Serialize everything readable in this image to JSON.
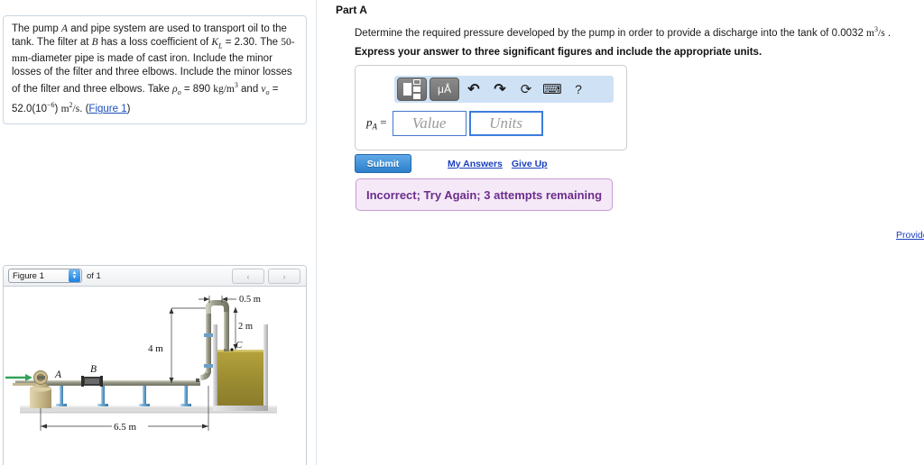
{
  "problem": {
    "segments": [
      {
        "t": "The pump ",
        "k": "plain"
      },
      {
        "t": "A",
        "k": "mathit"
      },
      {
        "t": " and pipe system are used to transport oil to the tank. The filter at ",
        "k": "plain"
      },
      {
        "t": "B",
        "k": "mathit"
      },
      {
        "t": " has a loss coefficient of ",
        "k": "plain"
      },
      {
        "t": "K",
        "k": "mathit"
      },
      {
        "t": "L",
        "k": "sub-it"
      },
      {
        "t": " = 2.30. The ",
        "k": "plain"
      },
      {
        "t": "50-mm",
        "k": "mathrm"
      },
      {
        "t": "-diameter pipe is made of cast iron. Include the minor losses of the filter and three elbows. Include the minor losses of the filter and three elbows. Take ",
        "k": "plain"
      },
      {
        "t": "ρ",
        "k": "mathit"
      },
      {
        "t": "o",
        "k": "sub-it"
      },
      {
        "t": " = 890 ",
        "k": "plain"
      },
      {
        "t": "kg/m",
        "k": "mathrm"
      },
      {
        "t": "3",
        "k": "sup"
      },
      {
        "t": " and ",
        "k": "plain"
      },
      {
        "t": "ν",
        "k": "mathit"
      },
      {
        "t": "o",
        "k": "sub-it"
      },
      {
        "t": " = 52.0(10",
        "k": "plain"
      },
      {
        "t": "−6",
        "k": "sup"
      },
      {
        "t": ") ",
        "k": "plain"
      },
      {
        "t": "m",
        "k": "mathrm"
      },
      {
        "t": "2",
        "k": "sup"
      },
      {
        "t": "/s",
        "k": "mathrm"
      },
      {
        "t": ". (",
        "k": "plain"
      }
    ],
    "figure_link": "Figure 1",
    "trailing": ")"
  },
  "figure_panel": {
    "select_value": "Figure 1",
    "of_label": "of 1",
    "prev_icon": "‹",
    "next_icon": "›",
    "spinner_up": "▲",
    "spinner_down": "▼",
    "diagram": {
      "labels": {
        "pump": "A",
        "filter": "B",
        "tank_level": "C",
        "dim_top": "0.5 m",
        "dim_riser": "2 m",
        "dim_height": "4 m",
        "dim_length": "6.5 m"
      },
      "colors": {
        "oil": "#9b8c32",
        "pipe": "#8d8d7a",
        "pump_body": "#c9b98b",
        "support": "#6fa8d0",
        "ground": "#d8d8d8",
        "flow_arrow": "#35a35a"
      }
    }
  },
  "part": {
    "title": "Part A",
    "question_pre": "Determine the required pressure developed by the pump in order to provide a discharge into the tank of 0.0032 ",
    "question_unit_base": "m",
    "question_unit_sup": "3",
    "question_unit_den": "/s",
    "question_post": " .",
    "instruction": "Express your answer to three significant figures and include the appropriate units."
  },
  "answer": {
    "toolbar": [
      {
        "name": "template-button",
        "label": "",
        "type": "button"
      },
      {
        "name": "units-button",
        "label": "μÅ",
        "type": "button"
      },
      {
        "name": "undo-icon",
        "label": "↶",
        "type": "icon"
      },
      {
        "name": "redo-icon",
        "label": "↷",
        "type": "icon"
      },
      {
        "name": "reset-icon",
        "label": "⟳",
        "type": "icon"
      },
      {
        "name": "keyboard-icon",
        "label": "⌨",
        "type": "icon"
      },
      {
        "name": "help-icon",
        "label": "?",
        "type": "icon"
      }
    ],
    "label_symbol": "p",
    "label_subscript": "A",
    "label_equals": " =",
    "value_placeholder": "Value",
    "units_placeholder": "Units",
    "value_current": "",
    "units_current": ""
  },
  "actions": {
    "submit_label": "Submit",
    "my_answers_label": "My Answers",
    "give_up_label": "Give Up"
  },
  "feedback": {
    "message": "Incorrect; Try Again; 3 attempts remaining",
    "text_color": "#6b2d8c",
    "background_color": "#f5e9f7",
    "border_color": "#c59cd0"
  },
  "footer": {
    "provide_feedback_label": "Provide"
  },
  "theme": {
    "link_color": "#1a3fbf",
    "submit_blue": "#2b7fcc",
    "toolbar_blue": "#cfe2f5",
    "field_border": "#4477cc"
  }
}
